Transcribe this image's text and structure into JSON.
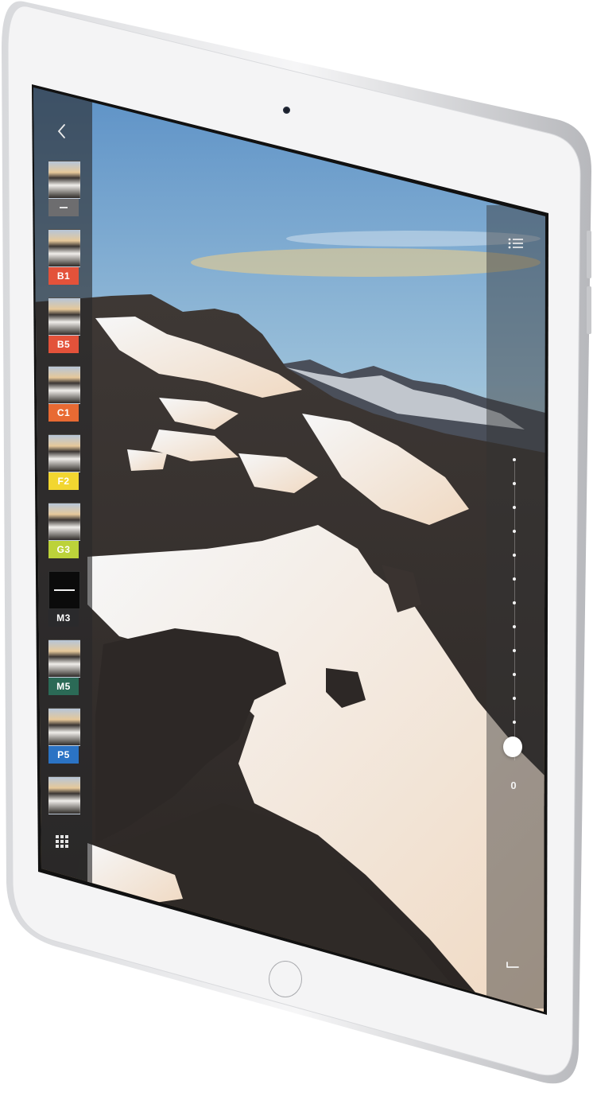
{
  "device": {
    "body_color": "#f3f3f4",
    "edge_color": "#c9cacd",
    "bezel_color": "#f5f5f6"
  },
  "icons": {
    "back": "chevron-left-icon",
    "grid": "grid-icon",
    "list": "list-icon",
    "undo": "undo-icon",
    "camera": "front-camera-icon",
    "home": "home-button"
  },
  "filter_strip": {
    "presets": [
      {
        "label": "",
        "color": "#6d6d6f",
        "selected": true
      },
      {
        "label": "B1",
        "color": "#e3523a"
      },
      {
        "label": "B5",
        "color": "#e3523a"
      },
      {
        "label": "C1",
        "color": "#e86a33"
      },
      {
        "label": "F2",
        "color": "#f2d630"
      },
      {
        "label": "G3",
        "color": "#bcd23a"
      },
      {
        "label": "M3",
        "color": "#2a2a2c"
      },
      {
        "label": "M5",
        "color": "#2b6a56"
      },
      {
        "label": "P5",
        "color": "#2b73c4"
      },
      {
        "label": "",
        "color": "#555557"
      }
    ]
  },
  "adjustment": {
    "value": "0",
    "steps": 12
  }
}
